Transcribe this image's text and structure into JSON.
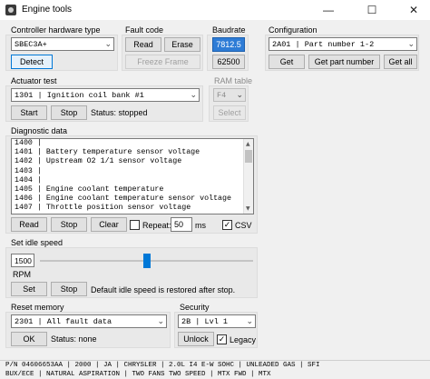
{
  "window": {
    "title": "Engine tools",
    "minimize": "—",
    "maximize": "☐",
    "close": "✕"
  },
  "controller": {
    "label": "Controller hardware type",
    "value": "SBEC3A+",
    "detect": "Detect"
  },
  "fault_code": {
    "label": "Fault code",
    "read": "Read",
    "erase": "Erase",
    "freeze": "Freeze Frame"
  },
  "baudrate": {
    "label": "Baudrate",
    "b1": "7812.5",
    "b2": "62500"
  },
  "configuration": {
    "label": "Configuration",
    "value": "2A01 | Part number 1-2",
    "get": "Get",
    "get_part": "Get part number",
    "get_all": "Get all"
  },
  "actuator": {
    "label": "Actuator test",
    "value": "1301 | Ignition coil bank #1",
    "start": "Start",
    "stop": "Stop",
    "status": "Status: stopped"
  },
  "ram_table": {
    "label": "RAM table",
    "value": "F4",
    "select": "Select"
  },
  "diagnostic": {
    "label": "Diagnostic data",
    "lines": [
      "1400 |",
      "1401 | Battery temperature sensor voltage",
      "1402 | Upstream O2 1/1 sensor voltage",
      "1403 |",
      "1404 |",
      "1405 | Engine coolant temperature",
      "1406 | Engine coolant temperature sensor voltage",
      "1407 | Throttle position sensor voltage"
    ],
    "read": "Read",
    "stop": "Stop",
    "clear": "Clear",
    "repeat_label": "Repeat:",
    "repeat_value": "50",
    "ms": "ms",
    "csv": "CSV",
    "check": "✓"
  },
  "idle": {
    "label": "Set idle speed",
    "value": "1500",
    "rpm": "RPM",
    "set": "Set",
    "stop": "Stop",
    "note": "Default idle speed is restored after stop.",
    "slider_fraction": 0.5
  },
  "reset": {
    "label": "Reset memory",
    "value": "2301 | All fault data",
    "ok": "OK",
    "status": "Status: none"
  },
  "security": {
    "label": "Security",
    "value": "2B | Lvl 1",
    "unlock": "Unlock",
    "legacy": "Legacy",
    "check": "✓"
  },
  "footer": {
    "line1": "P/N 04606653AA | 2000 | JA | CHRYSLER | 2.0L I4 E-W SOHC | UNLEADED GAS | SFI",
    "line2": "BUX/ECE | NATURAL ASPIRATION | TWO FANS TWO SPEED | MTX FWD | MTX"
  }
}
